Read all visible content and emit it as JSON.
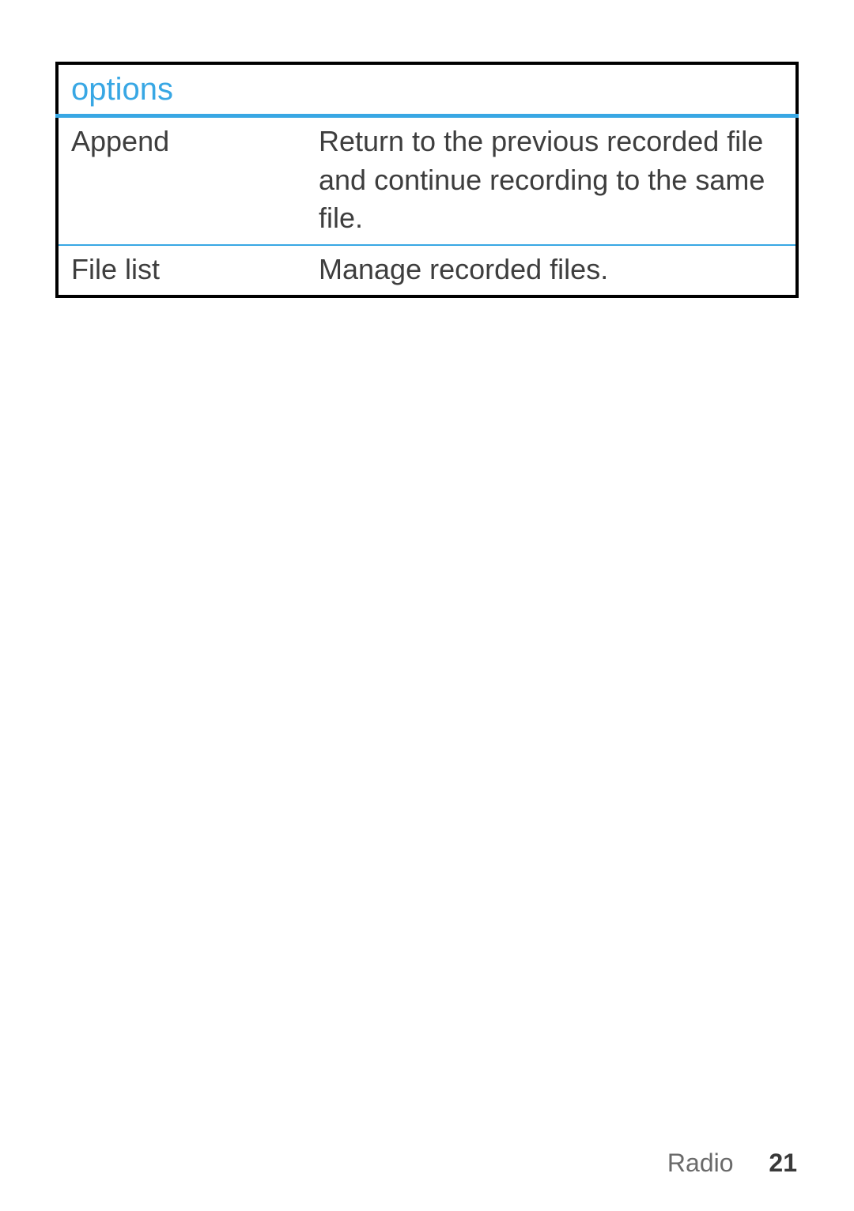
{
  "table": {
    "header": "options",
    "rows": [
      {
        "label": "Append",
        "desc": "Return to the previous recorded file and continue recording to the same file."
      },
      {
        "label": "File list",
        "desc": "Manage recorded files."
      }
    ]
  },
  "footer": {
    "section": "Radio",
    "page": "21"
  }
}
